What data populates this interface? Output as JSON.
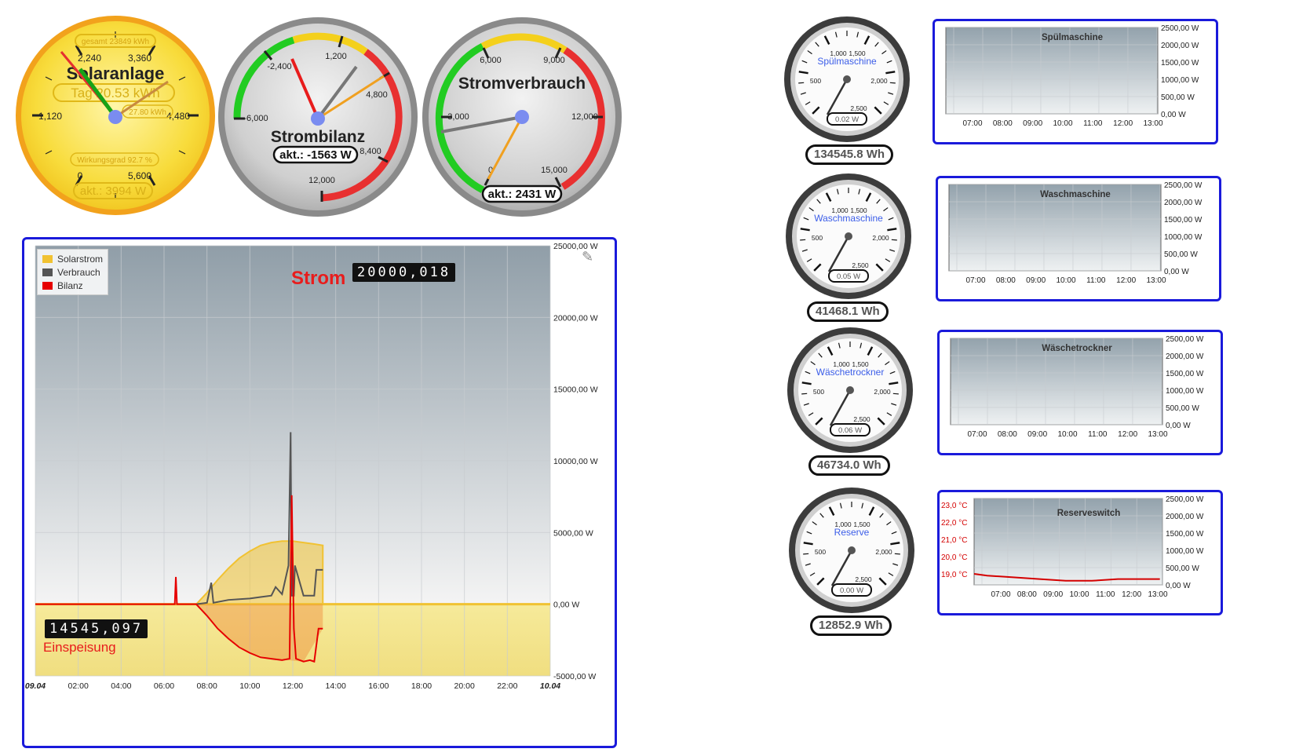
{
  "solar": {
    "title": "Solaranlage",
    "total": "gesamt 23849 kWh",
    "day": "Tag 20.53 kWh",
    "peak": "27.80 kWh",
    "efficiency": "Wirkungsgrad 92.7 %",
    "current": "akt.: 3994 W",
    "ticks": [
      "0",
      "1,120",
      "2,240",
      "3,360",
      "4,480",
      "5,600"
    ]
  },
  "balance": {
    "title": "Strombilanz",
    "current": "akt.: -1563 W",
    "ticks": [
      "-6,000",
      "-2,400",
      "1,200",
      "4,800",
      "8,400",
      "12,000"
    ]
  },
  "consumption": {
    "title": "Stromverbrauch",
    "current": "akt.: 2431 W",
    "ticks": [
      "0",
      "3,000",
      "6,000",
      "9,000",
      "12,000",
      "15,000"
    ]
  },
  "main_chart": {
    "title": "Strom",
    "meter_top": "20000,018",
    "meter_bottom": "14545,097",
    "feed_label": "Einspeisung",
    "legend": [
      "Solarstrom",
      "Verbrauch",
      "Bilanz"
    ],
    "colors": {
      "solar": "#f1c232",
      "consumption": "#555555",
      "balance": "#e60000"
    },
    "y_ticks": [
      "25000,00 W",
      "20000,00 W",
      "15000,00 W",
      "10000,00 W",
      "5000,00 W",
      "0,00 W",
      "-5000,00 W"
    ],
    "x_ticks": [
      "09.04",
      "02:00",
      "04:00",
      "06:00",
      "08:00",
      "10:00",
      "12:00",
      "14:00",
      "16:00",
      "18:00",
      "20:00",
      "22:00",
      "10.04"
    ]
  },
  "chart_data": [
    {
      "type": "line",
      "title": "Strom",
      "x_unit": "hour",
      "xlim": [
        0,
        24
      ],
      "ylim": [
        -5000,
        25000
      ],
      "series": [
        {
          "name": "Solarstrom",
          "x": [
            7.5,
            8.0,
            8.5,
            9.0,
            9.5,
            10.0,
            10.5,
            11.0,
            11.5,
            12.0,
            12.5,
            13.0,
            13.4
          ],
          "y": [
            0,
            800,
            1700,
            2500,
            3200,
            3700,
            4100,
            4300,
            4400,
            4400,
            4300,
            4200,
            4100
          ]
        },
        {
          "name": "Verbrauch",
          "x": [
            7.5,
            8.0,
            8.2,
            8.3,
            9.0,
            10.0,
            10.5,
            11.0,
            11.2,
            11.5,
            11.8,
            11.9,
            11.95,
            12.05,
            12.1,
            12.5,
            13.0,
            13.1,
            13.4
          ],
          "y": [
            0,
            100,
            1500,
            100,
            300,
            400,
            500,
            600,
            1200,
            700,
            2700,
            12000,
            600,
            600,
            2700,
            600,
            600,
            2400,
            2400
          ]
        },
        {
          "name": "Bilanz",
          "x": [
            0,
            6.0,
            6.5,
            6.55,
            6.6,
            7.5,
            8.0,
            8.5,
            9.0,
            9.5,
            10.0,
            10.5,
            11.0,
            11.5,
            11.85,
            11.95,
            12.05,
            12.15,
            12.5,
            12.8,
            13.0,
            13.2,
            13.4
          ],
          "y": [
            0,
            0,
            0,
            1900,
            0,
            0,
            -800,
            -1700,
            -2400,
            -3000,
            -3400,
            -3700,
            -3800,
            -3900,
            -3800,
            7600,
            -1700,
            -3800,
            -4000,
            -3900,
            -4000,
            -1700,
            -1700
          ]
        }
      ]
    },
    {
      "type": "line",
      "title": "Spülmaschine",
      "x_ticks": [
        "07:00",
        "08:00",
        "09:00",
        "10:00",
        "11:00",
        "12:00",
        "13:00"
      ],
      "ylim": [
        0,
        2500
      ],
      "series": []
    },
    {
      "type": "line",
      "title": "Waschmaschine",
      "x_ticks": [
        "07:00",
        "08:00",
        "09:00",
        "10:00",
        "11:00",
        "12:00",
        "13:00"
      ],
      "ylim": [
        0,
        2500
      ],
      "series": []
    },
    {
      "type": "line",
      "title": "Wäschetrockner",
      "x_ticks": [
        "07:00",
        "08:00",
        "09:00",
        "10:00",
        "11:00",
        "12:00",
        "13:00"
      ],
      "ylim": [
        0,
        2500
      ],
      "series": []
    },
    {
      "type": "line",
      "title": "Reserveswitch",
      "x_ticks": [
        "07:00",
        "08:00",
        "09:00",
        "10:00",
        "11:00",
        "12:00",
        "13:00"
      ],
      "ylim": [
        0,
        2500
      ],
      "y2_ticks": [
        "23,0 °C",
        "22,0 °C",
        "21,0 °C",
        "20,0 °C",
        "19,0 °C"
      ],
      "series": [
        {
          "x": [
            6.5,
            7.0,
            8.0,
            9.0,
            10.0,
            11.0,
            12.0,
            13.0,
            13.6
          ],
          "y": [
            19.0,
            18.9,
            18.8,
            18.7,
            18.6,
            18.6,
            18.7,
            18.7,
            18.7
          ]
        }
      ]
    }
  ],
  "devices": [
    {
      "name": "Spülmaschine",
      "power": "0.02 W",
      "energy": "134545.8 Wh",
      "chart_title": "Spülmaschine"
    },
    {
      "name": "Waschmaschine",
      "power": "0.05 W",
      "energy": "41468.1 Wh",
      "chart_title": "Waschmaschine"
    },
    {
      "name": "Wäschetrockner",
      "power": "0.06 W",
      "energy": "46734.0 Wh",
      "chart_title": "Wäschetrockner"
    },
    {
      "name": "Reserve",
      "power": "0.00 W",
      "energy": "12852.9 Wh",
      "chart_title": "Reserveswitch"
    }
  ],
  "device_gauge_ticks": [
    "500",
    "1,000",
    "1,500",
    "2,000",
    "2,500"
  ],
  "small_chart": {
    "y_ticks": [
      "2500,00 W",
      "2000,00 W",
      "1500,00 W",
      "1000,00 W",
      "500,00 W",
      "0,00 W"
    ],
    "x_ticks": [
      "07:00",
      "08:00",
      "09:00",
      "10:00",
      "11:00",
      "12:00",
      "13:00"
    ],
    "temp_ticks": [
      "23,0 °C",
      "22,0 °C",
      "21,0 °C",
      "20,0 °C",
      "19,0 °C"
    ],
    "temp_color": "#d40000"
  }
}
